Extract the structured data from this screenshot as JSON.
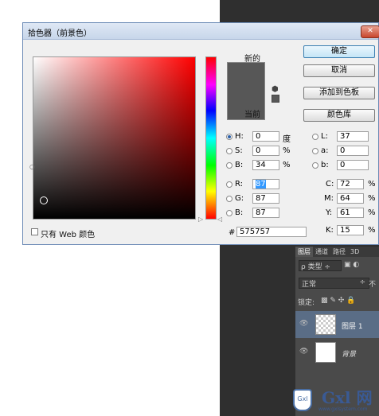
{
  "dialog": {
    "title": "拾色器（前景色）",
    "close": "✕",
    "new_label": "新的",
    "current_label": "当前",
    "new_color": "#575757",
    "current_color": "#575757",
    "buttons": {
      "ok": "确定",
      "cancel": "取消",
      "add_swatch": "添加到色板",
      "libraries": "颜色库"
    },
    "fields": {
      "H": {
        "label": "H:",
        "value": "0",
        "unit": "度",
        "selected": true
      },
      "S": {
        "label": "S:",
        "value": "0",
        "unit": "%"
      },
      "Bv": {
        "label": "B:",
        "value": "34",
        "unit": "%"
      },
      "R": {
        "label": "R:",
        "value": "87"
      },
      "G": {
        "label": "G:",
        "value": "87"
      },
      "Bl": {
        "label": "B:",
        "value": "87"
      },
      "L": {
        "label": "L:",
        "value": "37"
      },
      "a": {
        "label": "a:",
        "value": "0"
      },
      "b": {
        "label": "b:",
        "value": "0"
      },
      "C": {
        "label": "C:",
        "value": "72",
        "unit": "%"
      },
      "M": {
        "label": "M:",
        "value": "64",
        "unit": "%"
      },
      "Y": {
        "label": "Y:",
        "value": "61",
        "unit": "%"
      },
      "K": {
        "label": "K:",
        "value": "15",
        "unit": "%"
      }
    },
    "hex_hash": "#",
    "hex": "575757",
    "websafe_label": "只有 Web 颜色"
  },
  "layers_panel": {
    "tabs": [
      "图层",
      "通道",
      "路径",
      "3D"
    ],
    "kind_filter": "ρ 类型 ÷",
    "blend_mode": "正常",
    "blend_arrow": "÷",
    "opacity_label": "不",
    "lock_label": "锁定:",
    "lock_icons": "▩ ✎ ✣ 🔒",
    "layers": [
      {
        "name": "图层 1",
        "eye": "👁"
      },
      {
        "name": "背景",
        "eye": "👁"
      }
    ]
  },
  "watermark": {
    "brand": "Gxl 网",
    "url": "www.gxlsystem.com",
    "badge": "Gxl"
  }
}
